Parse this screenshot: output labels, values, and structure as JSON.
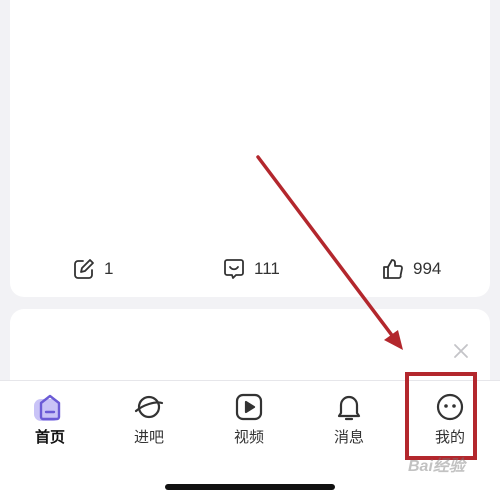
{
  "post_actions": {
    "share_count": "1",
    "comment_count": "111",
    "like_count": "994"
  },
  "tabbar": {
    "tabs": [
      {
        "label": "首页",
        "icon": "home-icon",
        "active": true
      },
      {
        "label": "进吧",
        "icon": "planet-icon",
        "active": false
      },
      {
        "label": "视频",
        "icon": "video-play-icon",
        "active": false
      },
      {
        "label": "消息",
        "icon": "bell-icon",
        "active": false
      },
      {
        "label": "我的",
        "icon": "face-icon",
        "active": false
      }
    ]
  },
  "annotation": {
    "color": "#b3272d",
    "target": "我的"
  },
  "watermark": {
    "text": "Bai经验"
  },
  "colors": {
    "accent": "#7b68ee",
    "annotation": "#b3272d"
  }
}
